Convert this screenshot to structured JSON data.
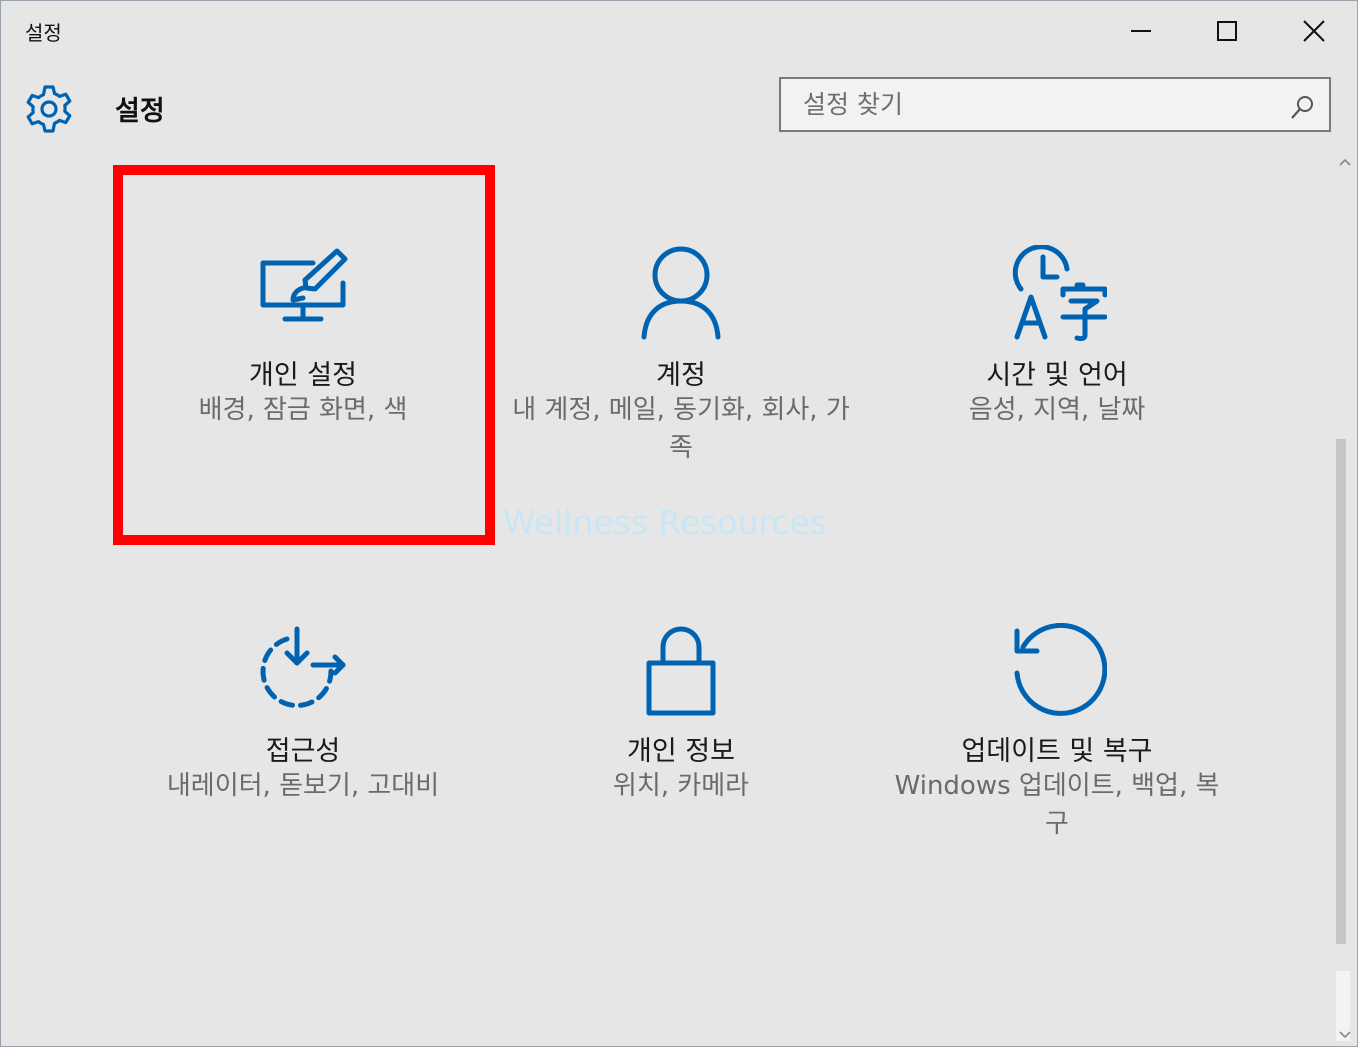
{
  "window": {
    "title": "설정",
    "controls": {
      "minimize_icon": "minimize-icon",
      "maximize_icon": "maximize-icon",
      "close_icon": "close-icon"
    }
  },
  "header": {
    "icon": "gear-icon",
    "title": "설정",
    "search": {
      "placeholder": "설정 찾기",
      "value": "",
      "icon": "search-icon"
    }
  },
  "categories": [
    {
      "name": "개인 설정",
      "description": "배경, 잠금 화면, 색",
      "icon": "personalization-icon"
    },
    {
      "name": "계정",
      "description": "내 계정, 메일, 동기화, 회사, 가족",
      "icon": "person-icon"
    },
    {
      "name": "시간 및 언어",
      "description": "음성, 지역, 날짜",
      "icon": "time-language-icon"
    },
    {
      "name": "접근성",
      "description": "내레이터, 돋보기, 고대비",
      "icon": "ease-of-access-icon"
    },
    {
      "name": "개인 정보",
      "description": "위치, 카메라",
      "icon": "lock-icon"
    },
    {
      "name": "업데이트 및 복구",
      "description": "Windows 업데이트, 백업, 복구",
      "icon": "refresh-icon"
    }
  ],
  "highlighted_category": "개인 설정",
  "watermark": "Wellness Resources",
  "colors": {
    "accent": "#0063b1",
    "highlight": "#ff0000",
    "background": "#e6e6e6"
  }
}
